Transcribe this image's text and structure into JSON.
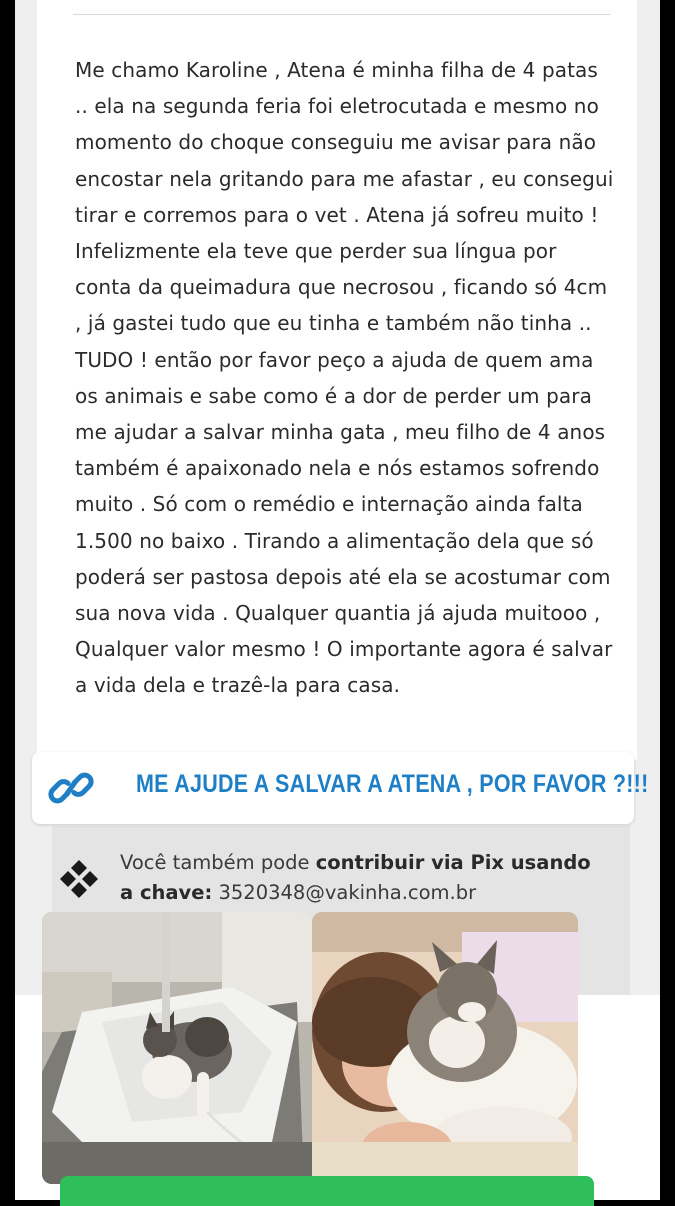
{
  "story": {
    "text": "Me chamo Karoline , Atena é minha filha de 4 patas .. ela na segunda feria foi eletrocutada e mesmo no momento do choque conseguiu me avisar para não encostar nela gritando para me afastar , eu consegui  tirar e corremos para o vet . Atena já sofreu muito ! Infelizmente ela teve que perder sua língua por conta da queimadura que necrosou , ficando só 4cm , já gastei tudo que eu tinha e também não tinha .. TUDO ! então por favor peço a ajuda de quem ama os animais e sabe como é a dor de perder um para me ajudar a salvar minha gata , meu filho de 4 anos também é apaixonado nela e nós estamos sofrendo muito . Só com o remédio e internação ainda falta 1.500 no baixo . Tirando a alimentação dela que só poderá ser pastosa depois até ela se acostumar com sua nova vida . Qualquer quantia  já ajuda muitooo , Qualquer valor mesmo ! O importante agora é salvar a vida dela e trazê-la para casa."
  },
  "link_banner": {
    "text": "ME AJUDE A SALVAR A ATENA , POR FAVOR ?!!!",
    "icon": "link-icon",
    "color": "#1f7fc6"
  },
  "pix": {
    "prefix": "Você também pode ",
    "bold": "contribuir via Pix usando a chave:",
    "key": " 3520348@vakinha.com.br",
    "icon": "pix-logo-icon"
  },
  "photos": [
    {
      "icon": "photo-cat-on-vet-table"
    },
    {
      "icon": "photo-child-with-cat"
    }
  ],
  "colors": {
    "accent": "#1f7fc6",
    "button_green": "#2fbf5a"
  }
}
